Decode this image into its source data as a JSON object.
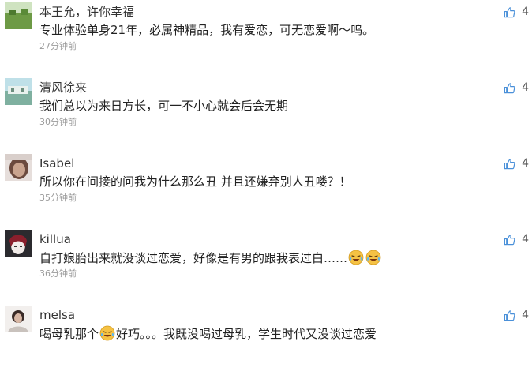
{
  "comments": [
    {
      "username": "本王允，许你幸福",
      "text": "专业体验单身21年，必属神精品，我有爱恋，可无恋爱啊～呜。",
      "time": "27分钟前",
      "likes": "4"
    },
    {
      "username": "清风徐来",
      "text": "我们总以为来日方长，可一不小心就会后会无期",
      "time": "30分钟前",
      "likes": "4"
    },
    {
      "username": "Isabel",
      "text": "所以你在间接的问我为什么那么丑 并且还嫌弃别人丑喽？！",
      "time": "35分钟前",
      "likes": "4"
    },
    {
      "username": "killua",
      "text": "自打娘胎出来就没谈过恋爱，好像是有男的跟我表过白……",
      "time": "36分钟前",
      "likes": "4"
    },
    {
      "username": "melsa",
      "text_part1": "喝母乳那个",
      "text_part2": "好巧。。。我既没喝过母乳，学生时代又没谈过恋爱",
      "likes": "4"
    }
  ],
  "icons": {
    "like": "thumbs-up-icon",
    "emoji": "laughing-crying-emoji"
  },
  "colors": {
    "like_icon": "#4a90d9",
    "time": "#9a9a9a"
  }
}
